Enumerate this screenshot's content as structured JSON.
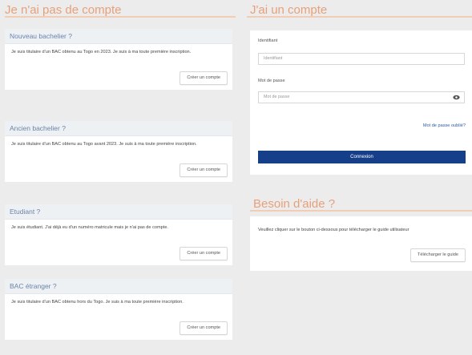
{
  "left": {
    "title": "Je n'ai pas de compte",
    "cards": [
      {
        "heading": "Nouveau bachelier ?",
        "text": "Je suis titulaire d'un BAC obtenu au Togo en 2023. Je suis à ma toute première inscription.",
        "button": "Créer un compte"
      },
      {
        "heading": "Ancien bachelier ?",
        "text": "Je suis titulaire d'un BAC obtenu au Togo avant 2023. Je suis à ma toute première inscription.",
        "button": "Créer un compte"
      },
      {
        "heading": "Etudiant ?",
        "text": "Je suis étudiant. J'ai déjà eu d'un numéro matricule mais je n'ai pas de compte.",
        "button": "Créer un compte"
      },
      {
        "heading": "BAC étranger ?",
        "text": "Je suis titulaire d'un BAC obtenu hors du Togo. Je suis à ma toute première inscription.",
        "button": "Créer un compte"
      }
    ]
  },
  "login": {
    "title": "J'ai un compte",
    "id_label": "Identifiant",
    "id_placeholder": "Identifiant",
    "pwd_label": "Mot de passe",
    "pwd_placeholder": "Mot de passe",
    "forgot": "Mot de passe oublié?",
    "submit": "Connexion",
    "accent_color": "#163f8a"
  },
  "help": {
    "title": "Besoin d'aide ?",
    "text": "Veuillez cliquer sur le bouton ci-dessous pour télécharger le guide utilisateur",
    "button": "Télécharger le guide"
  }
}
